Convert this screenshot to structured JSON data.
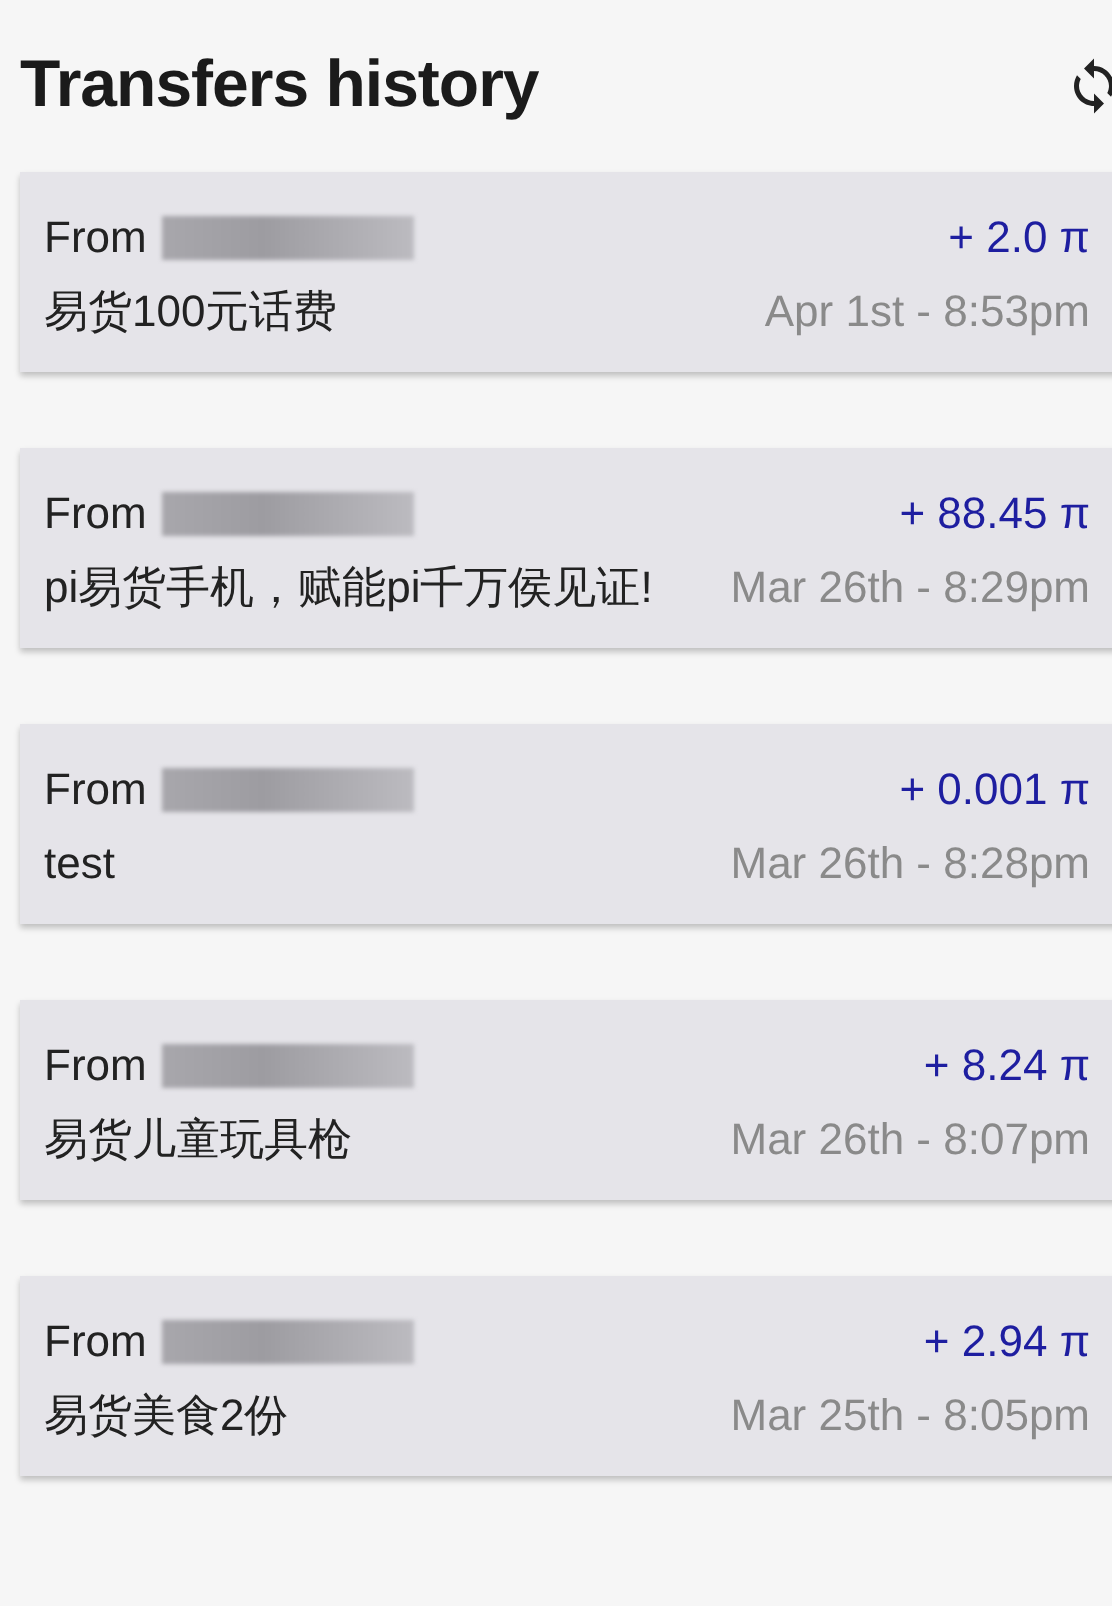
{
  "header": {
    "title": "Transfers history"
  },
  "transfers": [
    {
      "from_label": "From",
      "amount": "+ 2.0 π",
      "note": "易货100元话费",
      "date": "Apr 1st - 8:53pm"
    },
    {
      "from_label": "From",
      "amount": "+ 88.45 π",
      "note": "pi易货手机，赋能pi千万侯见证!",
      "date": "Mar 26th - 8:29pm"
    },
    {
      "from_label": "From",
      "amount": "+ 0.001 π",
      "note": "test",
      "date": "Mar 26th - 8:28pm"
    },
    {
      "from_label": "From",
      "amount": "+ 8.24 π",
      "note": "易货儿童玩具枪",
      "date": "Mar 26th - 8:07pm"
    },
    {
      "from_label": "From",
      "amount": "+ 2.94 π",
      "note": "易货美食2份",
      "date": "Mar 25th - 8:05pm"
    }
  ]
}
